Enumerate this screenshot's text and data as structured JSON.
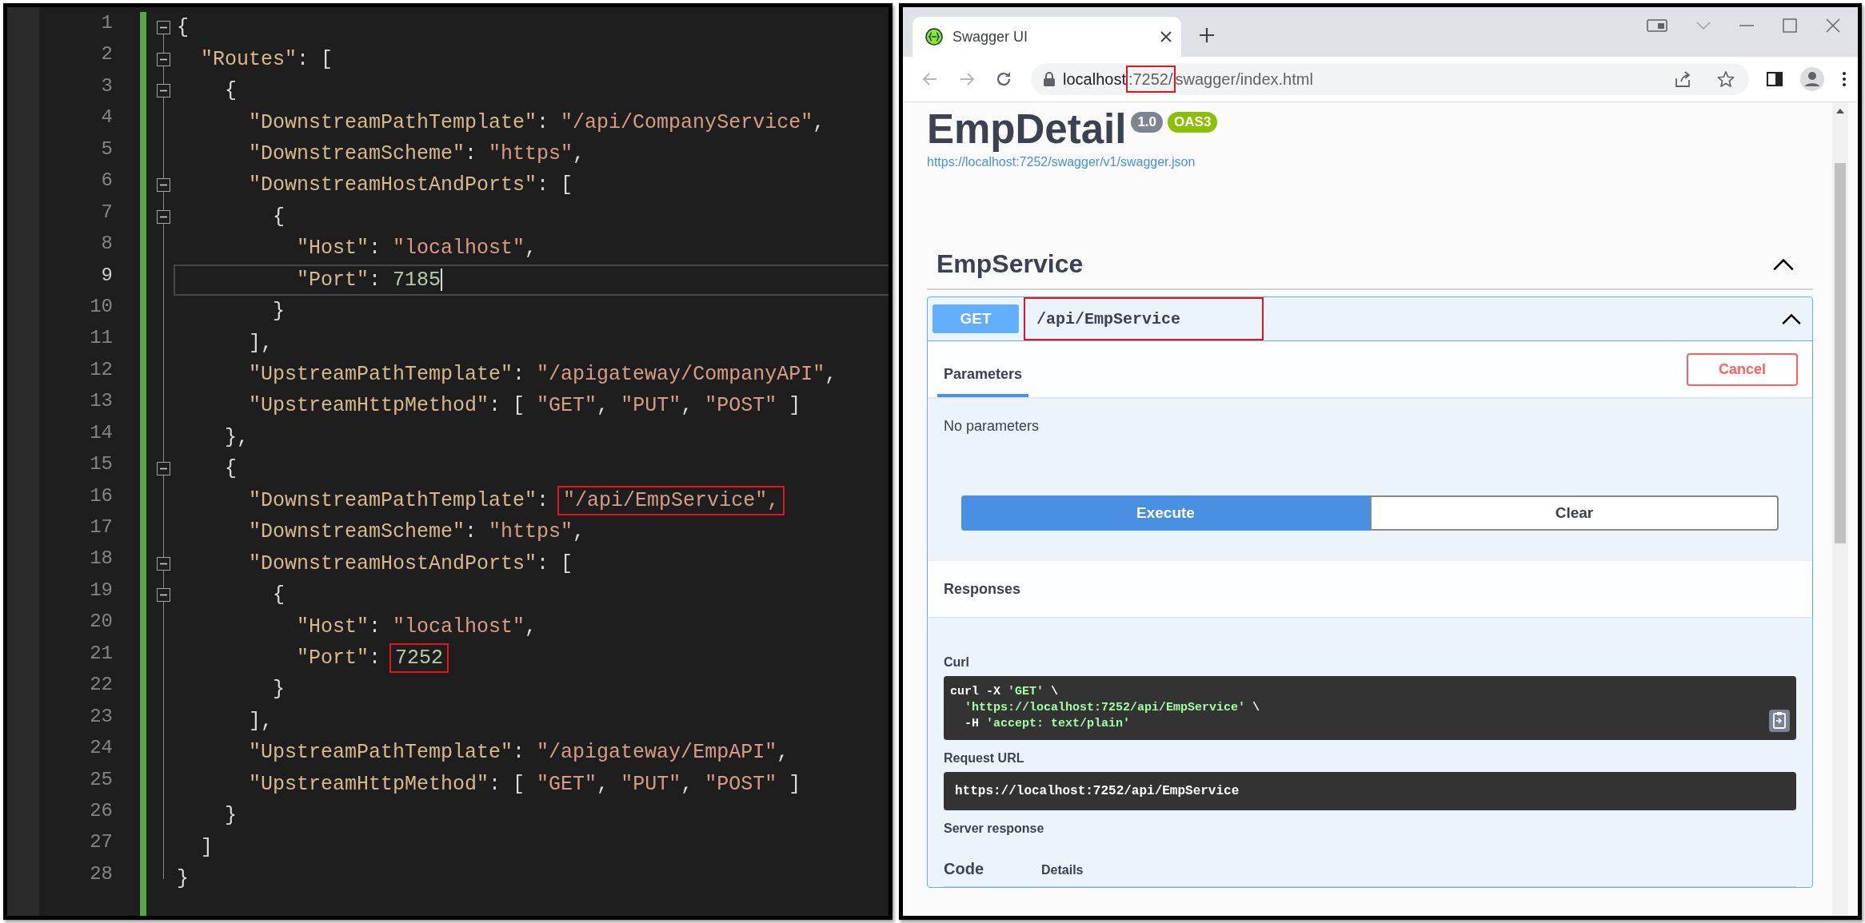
{
  "editor": {
    "lines": [
      {
        "number": "1",
        "current": false,
        "fold": true,
        "tokens": [
          {
            "kind": "punct",
            "text": "{"
          }
        ]
      },
      {
        "number": "2",
        "current": false,
        "fold": true,
        "tokens": [
          {
            "kind": "key",
            "text": "  \"Routes\""
          },
          {
            "kind": "punct",
            "text": ": ["
          }
        ]
      },
      {
        "number": "3",
        "current": false,
        "fold": true,
        "tokens": [
          {
            "kind": "punct",
            "text": "    {"
          }
        ]
      },
      {
        "number": "4",
        "current": false,
        "fold": false,
        "tokens": [
          {
            "kind": "key",
            "text": "      \"DownstreamPathTemplate\""
          },
          {
            "kind": "punct",
            "text": ": "
          },
          {
            "kind": "string",
            "text": "\"/api/CompanyService\""
          },
          {
            "kind": "punct",
            "text": ","
          }
        ]
      },
      {
        "number": "5",
        "current": false,
        "fold": false,
        "tokens": [
          {
            "kind": "key",
            "text": "      \"DownstreamScheme\""
          },
          {
            "kind": "punct",
            "text": ": "
          },
          {
            "kind": "string",
            "text": "\"https\""
          },
          {
            "kind": "punct",
            "text": ","
          }
        ]
      },
      {
        "number": "6",
        "current": false,
        "fold": true,
        "tokens": [
          {
            "kind": "key",
            "text": "      \"DownstreamHostAndPorts\""
          },
          {
            "kind": "punct",
            "text": ": ["
          }
        ]
      },
      {
        "number": "7",
        "current": false,
        "fold": true,
        "tokens": [
          {
            "kind": "punct",
            "text": "        {"
          }
        ]
      },
      {
        "number": "8",
        "current": false,
        "fold": false,
        "tokens": [
          {
            "kind": "key",
            "text": "          \"Host\""
          },
          {
            "kind": "punct",
            "text": ": "
          },
          {
            "kind": "string",
            "text": "\"localhost\""
          },
          {
            "kind": "punct",
            "text": ","
          }
        ]
      },
      {
        "number": "9",
        "current": true,
        "fold": false,
        "tokens": [
          {
            "kind": "key",
            "text": "          \"Port\""
          },
          {
            "kind": "punct",
            "text": ": "
          },
          {
            "kind": "number",
            "text": "7185"
          }
        ]
      },
      {
        "number": "10",
        "current": false,
        "fold": false,
        "tokens": [
          {
            "kind": "punct",
            "text": "        }"
          }
        ]
      },
      {
        "number": "11",
        "current": false,
        "fold": false,
        "tokens": [
          {
            "kind": "punct",
            "text": "      ],"
          }
        ]
      },
      {
        "number": "12",
        "current": false,
        "fold": false,
        "tokens": [
          {
            "kind": "key",
            "text": "      \"UpstreamPathTemplate\""
          },
          {
            "kind": "punct",
            "text": ": "
          },
          {
            "kind": "string",
            "text": "\"/apigateway/CompanyAPI\""
          },
          {
            "kind": "punct",
            "text": ","
          }
        ]
      },
      {
        "number": "13",
        "current": false,
        "fold": false,
        "tokens": [
          {
            "kind": "key",
            "text": "      \"UpstreamHttpMethod\""
          },
          {
            "kind": "punct",
            "text": ": [ "
          },
          {
            "kind": "string",
            "text": "\"GET\""
          },
          {
            "kind": "punct",
            "text": ", "
          },
          {
            "kind": "string",
            "text": "\"PUT\""
          },
          {
            "kind": "punct",
            "text": ", "
          },
          {
            "kind": "string",
            "text": "\"POST\""
          },
          {
            "kind": "punct",
            "text": " ]"
          }
        ]
      },
      {
        "number": "14",
        "current": false,
        "fold": false,
        "tokens": [
          {
            "kind": "punct",
            "text": "    },"
          }
        ]
      },
      {
        "number": "15",
        "current": false,
        "fold": true,
        "tokens": [
          {
            "kind": "punct",
            "text": "    {"
          }
        ]
      },
      {
        "number": "16",
        "current": false,
        "fold": false,
        "tokens": [
          {
            "kind": "key",
            "text": "      \"DownstreamPathTemplate\""
          },
          {
            "kind": "punct",
            "text": ": "
          },
          {
            "kind": "string",
            "text": "\"/api/EmpService\",",
            "highlighted": true
          }
        ]
      },
      {
        "number": "17",
        "current": false,
        "fold": false,
        "tokens": [
          {
            "kind": "key",
            "text": "      \"DownstreamScheme\""
          },
          {
            "kind": "punct",
            "text": ": "
          },
          {
            "kind": "string",
            "text": "\"https\""
          },
          {
            "kind": "punct",
            "text": ","
          }
        ]
      },
      {
        "number": "18",
        "current": false,
        "fold": true,
        "tokens": [
          {
            "kind": "key",
            "text": "      \"DownstreamHostAndPorts\""
          },
          {
            "kind": "punct",
            "text": ": ["
          }
        ]
      },
      {
        "number": "19",
        "current": false,
        "fold": true,
        "tokens": [
          {
            "kind": "punct",
            "text": "        {"
          }
        ]
      },
      {
        "number": "20",
        "current": false,
        "fold": false,
        "tokens": [
          {
            "kind": "key",
            "text": "          \"Host\""
          },
          {
            "kind": "punct",
            "text": ": "
          },
          {
            "kind": "string",
            "text": "\"localhost\""
          },
          {
            "kind": "punct",
            "text": ","
          }
        ]
      },
      {
        "number": "21",
        "current": false,
        "fold": false,
        "tokens": [
          {
            "kind": "key",
            "text": "          \"Port\""
          },
          {
            "kind": "punct",
            "text": ": "
          },
          {
            "kind": "number",
            "text": "7252",
            "highlighted": true
          }
        ]
      },
      {
        "number": "22",
        "current": false,
        "fold": false,
        "tokens": [
          {
            "kind": "punct",
            "text": "        }"
          }
        ]
      },
      {
        "number": "23",
        "current": false,
        "fold": false,
        "tokens": [
          {
            "kind": "punct",
            "text": "      ],"
          }
        ]
      },
      {
        "number": "24",
        "current": false,
        "fold": false,
        "tokens": [
          {
            "kind": "key",
            "text": "      \"UpstreamPathTemplate\""
          },
          {
            "kind": "punct",
            "text": ": "
          },
          {
            "kind": "string",
            "text": "\"/apigateway/EmpAPI\""
          },
          {
            "kind": "punct",
            "text": ","
          }
        ]
      },
      {
        "number": "25",
        "current": false,
        "fold": false,
        "tokens": [
          {
            "kind": "key",
            "text": "      \"UpstreamHttpMethod\""
          },
          {
            "kind": "punct",
            "text": ": [ "
          },
          {
            "kind": "string",
            "text": "\"GET\""
          },
          {
            "kind": "punct",
            "text": ", "
          },
          {
            "kind": "string",
            "text": "\"PUT\""
          },
          {
            "kind": "punct",
            "text": ", "
          },
          {
            "kind": "string",
            "text": "\"POST\""
          },
          {
            "kind": "punct",
            "text": " ]"
          }
        ]
      },
      {
        "number": "26",
        "current": false,
        "fold": false,
        "tokens": [
          {
            "kind": "punct",
            "text": "    }"
          }
        ]
      },
      {
        "number": "27",
        "current": false,
        "fold": false,
        "tokens": [
          {
            "kind": "punct",
            "text": "  ]"
          }
        ]
      },
      {
        "number": "28",
        "current": false,
        "fold": false,
        "tokens": [
          {
            "kind": "punct",
            "text": "}"
          }
        ]
      }
    ]
  },
  "browser": {
    "tabs": [
      {
        "title": "Swagger UI",
        "selected": true
      }
    ],
    "nav_buttons": [
      {
        "kind": "back",
        "disabled": true
      },
      {
        "kind": "forward",
        "disabled": true
      },
      {
        "kind": "reload",
        "disabled": false
      }
    ],
    "address": {
      "parts": [
        {
          "kind": "host",
          "text": "localhost",
          "highlighted": false
        },
        {
          "kind": "path",
          "text": ":7252/",
          "highlighted": true
        },
        {
          "kind": "path",
          "text": "swagger/index.html",
          "highlighted": false
        }
      ]
    },
    "page": {
      "title": "EmpDetail",
      "version": "1.0",
      "spec": "OAS3",
      "spec_link": "https://localhost:7252/swagger/v1/swagger.json",
      "section": {
        "name": "EmpService",
        "expanded": true
      },
      "operation": {
        "method": "GET",
        "path": "/api/EmpService",
        "path_highlighted": true,
        "expanded": true,
        "tabs": [
          {
            "label": "Parameters",
            "selected": true
          }
        ],
        "cancel": "Cancel",
        "no_params": "No parameters",
        "execute": "Execute",
        "clear": "Clear",
        "responses_heading": "Responses",
        "curl_label": "Curl",
        "curl_lines": [
          [
            {
              "kind": "plain",
              "text": "curl -X "
            },
            {
              "kind": "string",
              "text": "'GET'"
            },
            {
              "kind": "plain",
              "text": " \\"
            }
          ],
          [
            {
              "kind": "string",
              "text": "  'https://localhost:7252/api/EmpService'"
            },
            {
              "kind": "plain",
              "text": " \\"
            }
          ],
          [
            {
              "kind": "plain",
              "text": "  -H "
            },
            {
              "kind": "string",
              "text": "'accept: text/plain'"
            }
          ]
        ],
        "request_url_label": "Request URL",
        "request_url": "https://localhost:7252/api/EmpService",
        "server_response_label": "Server response",
        "columns": [
          "Code",
          "Details"
        ]
      }
    }
  }
}
